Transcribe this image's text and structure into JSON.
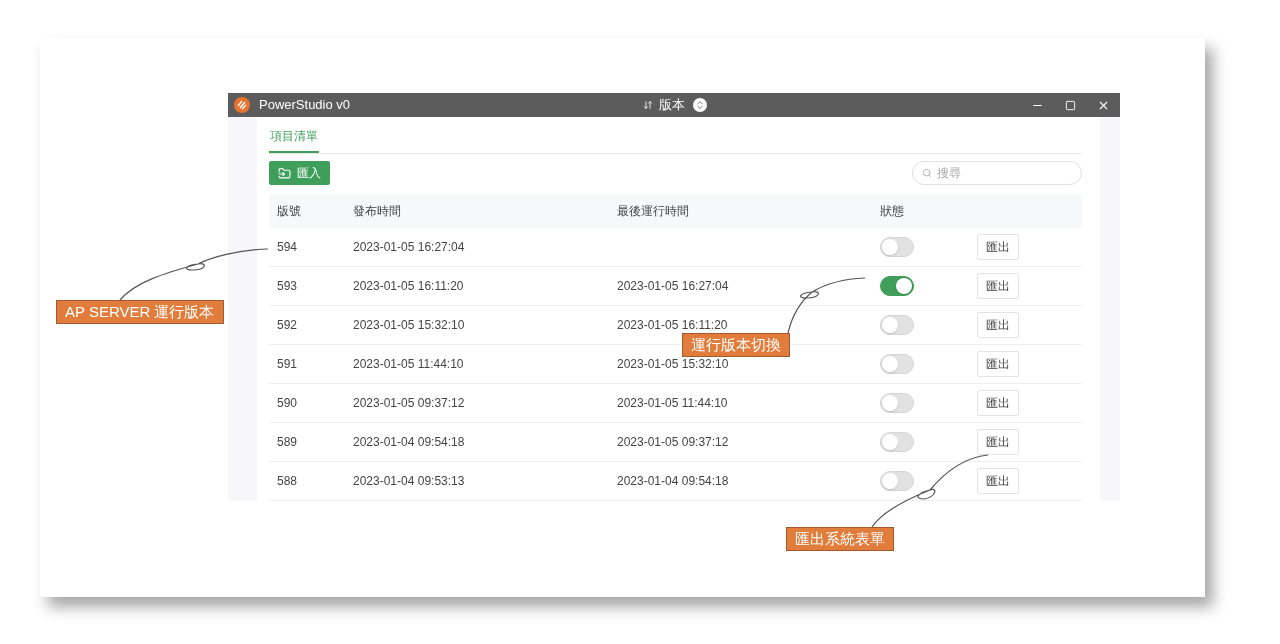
{
  "window": {
    "title": "PowerStudio v0",
    "view_selector": "版本"
  },
  "tabs": [
    {
      "label": "項目清單",
      "selected": true
    }
  ],
  "toolbar": {
    "import_button": "匯入",
    "search": {
      "placeholder": "搜尋"
    }
  },
  "table": {
    "columns": [
      "版號",
      "發布時間",
      "最後運行時間",
      "狀態"
    ],
    "rows": [
      {
        "version": "594",
        "published": "2023-01-05 16:27:04",
        "on": false,
        "action": "匯出"
      },
      {
        "version": "593",
        "published": "2023-01-05 16:11:20",
        "last_run": "2023-01-05 16:27:04",
        "on": true,
        "action": "匯出"
      },
      {
        "version": "592",
        "published": "2023-01-05 15:32:10",
        "last_run": "2023-01-05 16:11:20",
        "on": false,
        "action": "匯出"
      },
      {
        "version": "591",
        "published": "2023-01-05 11:44:10",
        "last_run": "2023-01-05 15:32:10",
        "on": false,
        "action": "匯出"
      },
      {
        "version": "590",
        "published": "2023-01-05 09:37:12",
        "last_run": "2023-01-05 11:44:10",
        "on": false,
        "action": "匯出"
      },
      {
        "version": "589",
        "published": "2023-01-04 09:54:18",
        "last_run": "2023-01-05 09:37:12",
        "on": false,
        "action": "匯出"
      },
      {
        "version": "588",
        "published": "2023-01-04 09:53:13",
        "last_run": "2023-01-04 09:54:18",
        "on": false,
        "action": "匯出"
      }
    ]
  },
  "annotations": [
    {
      "text": "AP SERVER 運行版本"
    },
    {
      "text": "運行版本切換"
    },
    {
      "text": "匯出系統表單"
    }
  ]
}
